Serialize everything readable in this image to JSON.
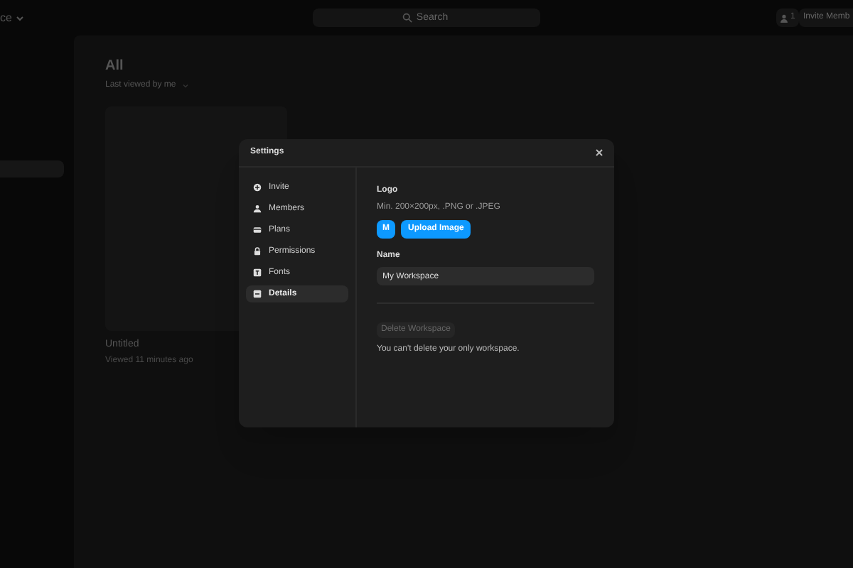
{
  "topbar": {
    "workspace": "ce",
    "search": {
      "placeholder": "Search"
    },
    "member_count": "1",
    "invite_button": "Invite Memb"
  },
  "sidebar": {
    "items": [
      {
        "selected": true
      }
    ]
  },
  "main": {
    "title": "All",
    "sort": "Last viewed by me",
    "files": [
      {
        "name": "Untitled",
        "meta": "Viewed 11 minutes ago"
      }
    ]
  },
  "dialog": {
    "title": "Settings",
    "nav": [
      {
        "label": "Invite",
        "kind": "invite",
        "selected": false
      },
      {
        "label": "Members",
        "kind": "members",
        "selected": false
      },
      {
        "label": "Plans",
        "kind": "plans",
        "selected": false
      },
      {
        "label": "Permissions",
        "kind": "permissions",
        "selected": false
      },
      {
        "label": "Fonts",
        "kind": "fonts",
        "selected": false
      },
      {
        "label": "Details",
        "kind": "details",
        "selected": true
      }
    ],
    "logo": {
      "heading": "Logo",
      "hint": "Min. 200×200px, .PNG or .JPEG",
      "avatar": "M",
      "upload_button": "Upload Image"
    },
    "name": {
      "heading": "Name",
      "value": "My Workspace"
    },
    "delete_button": {
      "label": "Delete Workspace",
      "disabled": true
    },
    "delete_note": "You can't delete your only workspace."
  }
}
